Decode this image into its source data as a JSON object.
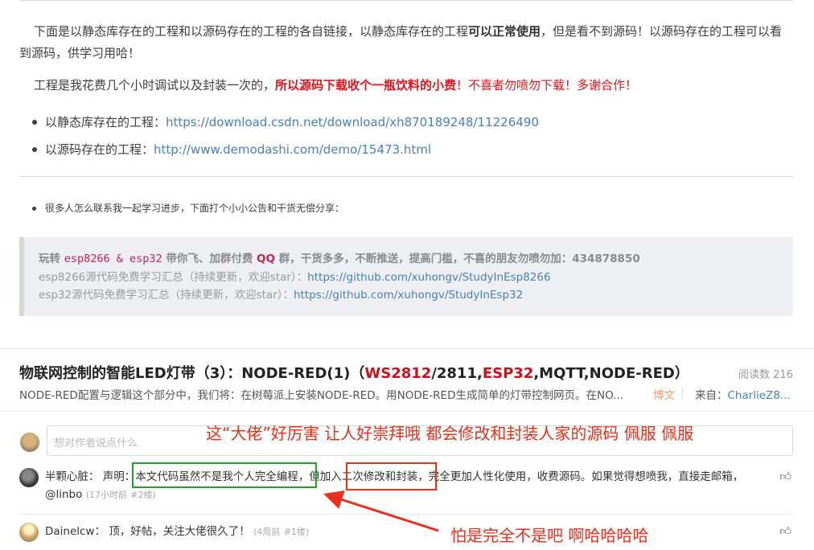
{
  "post": {
    "para1": {
      "text_before": "下面是以静态库存在的工程和以源码存在的工程的各自链接，以静态库存在的工程",
      "emphasis": "可以正常使用",
      "text_after": "，但是看不到源码！以源码存在的工程可以看到源码，供学习用哈！"
    },
    "para2": {
      "text_before": "工程是我花费几个小时调试以及封装一次的，",
      "red_bold": "所以源码下载收个一瓶饮料的小费",
      "red": "！不喜者勿喷勿下载！多谢合作！"
    },
    "links": [
      {
        "label": "以静态库存在的工程：",
        "url": "https://download.csdn.net/download/xh870189248/11226490"
      },
      {
        "label": "以源码存在的工程：",
        "url": "http://www.demodashi.com/demo/15473.html"
      }
    ],
    "note": "很多人怎么联系我一起学习进步，下面打个小小公告和干货无偿分享：",
    "quote": {
      "line1_prefix": "玩转 ",
      "line1_code1": "esp8266",
      "line1_amp": " & ",
      "line1_code2": "esp32",
      "line1_mid": " 带你飞、加群付费 ",
      "line1_qq": "QQ",
      "line1_suffix": " 群，干货多多，不断推送，提高门槛，不喜的朋友勿喷勿加：434878850",
      "line2_label": "esp8266源代码免费学习汇总（持续更新，欢迎star）：",
      "line2_url": "https://github.com/xuhongv/StudyInEsp8266",
      "line3_label": "esp32源代码免费学习汇总（持续更新，欢迎star）：",
      "line3_url": "https://github.com/xuhongv/StudyInEsp32"
    }
  },
  "article": {
    "title_part1": "物联网控制的智能LED灯带（3）：NODE-RED(1)（",
    "title_hl1": "WS2812",
    "title_part2": "/2811,",
    "title_hl2": "ESP32",
    "title_part3": ",MQTT,NODE-RED）",
    "read_count": "阅读数 216",
    "description": "NODE-RED配置与逻辑这个部分中，我们将：在树莓派上安装NODE-RED。用NODE-RED生成简单的灯带控制网页。在NO...",
    "tag": "博文",
    "from_label": "来自：",
    "author": "CharlieZ8..."
  },
  "comments": {
    "input_placeholder": "想对作者说点什么",
    "items": [
      {
        "author": "半颗心脏：",
        "text": " 声明：本文代码虽然不是我个人完全编程，但加入二次修改和封装，完全更加人性化使用，收费源码。如果觉得想喷我，直接走邮箱，@linbo",
        "time": "(17小时前",
        "floor": "#2楼)"
      },
      {
        "author": "Dainelcw：",
        "text": " 顶，好帖，关注大佬很久了！",
        "time": "(4周前",
        "floor": "#1楼)"
      }
    ]
  },
  "annotations": {
    "top": "这“大佬”好厉害 让人好崇拜哦  都会修改和封装人家的源码  佩服  佩服",
    "bottom": "怕是完全不是吧  啊哈哈哈哈"
  },
  "colors": {
    "link": "#4a80b5",
    "red": "#e0151c",
    "annotation_red": "#e8301e",
    "annotation_green": "#1fa12b"
  }
}
